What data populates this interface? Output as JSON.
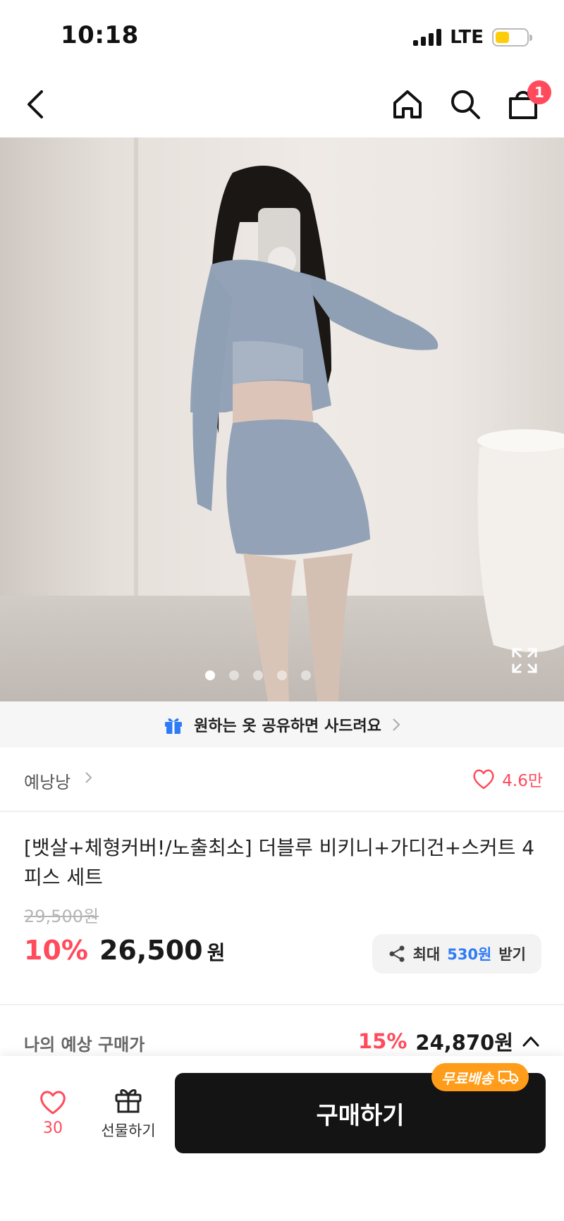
{
  "status_bar": {
    "time": "10:18",
    "network": "LTE",
    "battery_level": 0.45,
    "battery_color": "#ffcc0a"
  },
  "nav": {
    "back_icon": "chevron-left-icon",
    "home_icon": "home-icon",
    "search_icon": "search-icon",
    "cart_icon": "shopping-bag-icon",
    "cart_badge": "1"
  },
  "gallery": {
    "total_images": 5,
    "active_index": 0,
    "expand_icon": "expand-icon"
  },
  "share_banner": {
    "text": "원하는 옷 공유하면 사드려요",
    "icon": "gift-icon"
  },
  "store": {
    "name": "예낭낭",
    "like_count": "4.6만"
  },
  "product": {
    "title": "[뱃살+체형커버!/노출최소] 더블루 비키니+가디건+스커트 4피스 세트",
    "original_price": "29,500원",
    "discount": "10%",
    "sale_price": "26,500",
    "currency": "원"
  },
  "reward": {
    "prefix": "최대",
    "amount": "530원",
    "suffix": "받기"
  },
  "expected_price": {
    "label": "나의 예상 구매가",
    "discount": "15%",
    "price": "24,870원"
  },
  "bottom_bar": {
    "wish_count": "30",
    "gift_label": "선물하기",
    "buy_label": "구매하기",
    "free_shipping_label": "무료배송"
  },
  "colors": {
    "accent_red": "#ff4b5c",
    "accent_blue": "#2f7bf6",
    "shipping_orange": "#ff9d1b"
  }
}
